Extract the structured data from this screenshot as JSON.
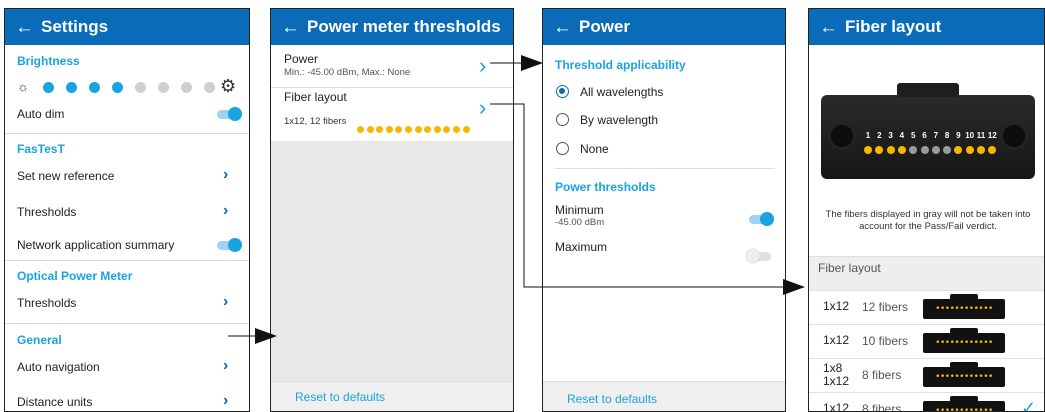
{
  "colors": {
    "appbar": "#0a6cb8",
    "accent": "#1aa3e0",
    "fiber_on": "#f5b800",
    "fiber_off": "#9a9a9a"
  },
  "settings": {
    "back_icon": "arrow-left-icon",
    "title": "Settings",
    "brightness_header": "Brightness",
    "brightness_level": 0.5,
    "auto_dim": "Auto dim",
    "fastest_header": "FasTesT",
    "set_new_reference": "Set new reference",
    "thresholds": "Thresholds",
    "network_summary": "Network application summary",
    "opm_header": "Optical Power Meter",
    "opm_thresholds": "Thresholds",
    "general_header": "General",
    "auto_navigation": "Auto navigation",
    "distance_units": "Distance units"
  },
  "pm_thresholds": {
    "title": "Power meter thresholds",
    "power_label": "Power",
    "power_sub": "Min.: -45.00 dBm, Max.: None",
    "fiber_label": "Fiber layout",
    "fiber_sub": "1x12, 12 fibers",
    "reset": "Reset to defaults"
  },
  "power": {
    "title": "Power",
    "applicability_header": "Threshold applicability",
    "options": [
      "All wavelengths",
      "By wavelength",
      "None"
    ],
    "selected": "All wavelengths",
    "thresholds_header": "Power thresholds",
    "minimum_label": "Minimum",
    "minimum_value": "-45.00 dBm",
    "minimum_enabled": true,
    "maximum_label": "Maximum",
    "maximum_enabled": false,
    "reset": "Reset to defaults"
  },
  "fiber_layout": {
    "title": "Fiber layout",
    "fiber_numbers": [
      "1",
      "2",
      "3",
      "4",
      "5",
      "6",
      "7",
      "8",
      "9",
      "10",
      "11",
      "12"
    ],
    "fiber_active": [
      true,
      true,
      true,
      true,
      false,
      false,
      false,
      false,
      true,
      true,
      true,
      true
    ],
    "note": "The fibers displayed in gray will not be taken into account for the Pass/Fail verdict.",
    "list_header": "Fiber layout",
    "rows": [
      {
        "type": "1x12",
        "fibers": "12 fibers",
        "selected": false
      },
      {
        "type": "1x12",
        "fibers": "10 fibers",
        "selected": false
      },
      {
        "type": "1x8\n1x12",
        "fibers": "8 fibers",
        "selected": false
      },
      {
        "type": "1x12",
        "fibers": "8 fibers",
        "selected": true
      }
    ],
    "check_icon": "checkmark-icon"
  }
}
